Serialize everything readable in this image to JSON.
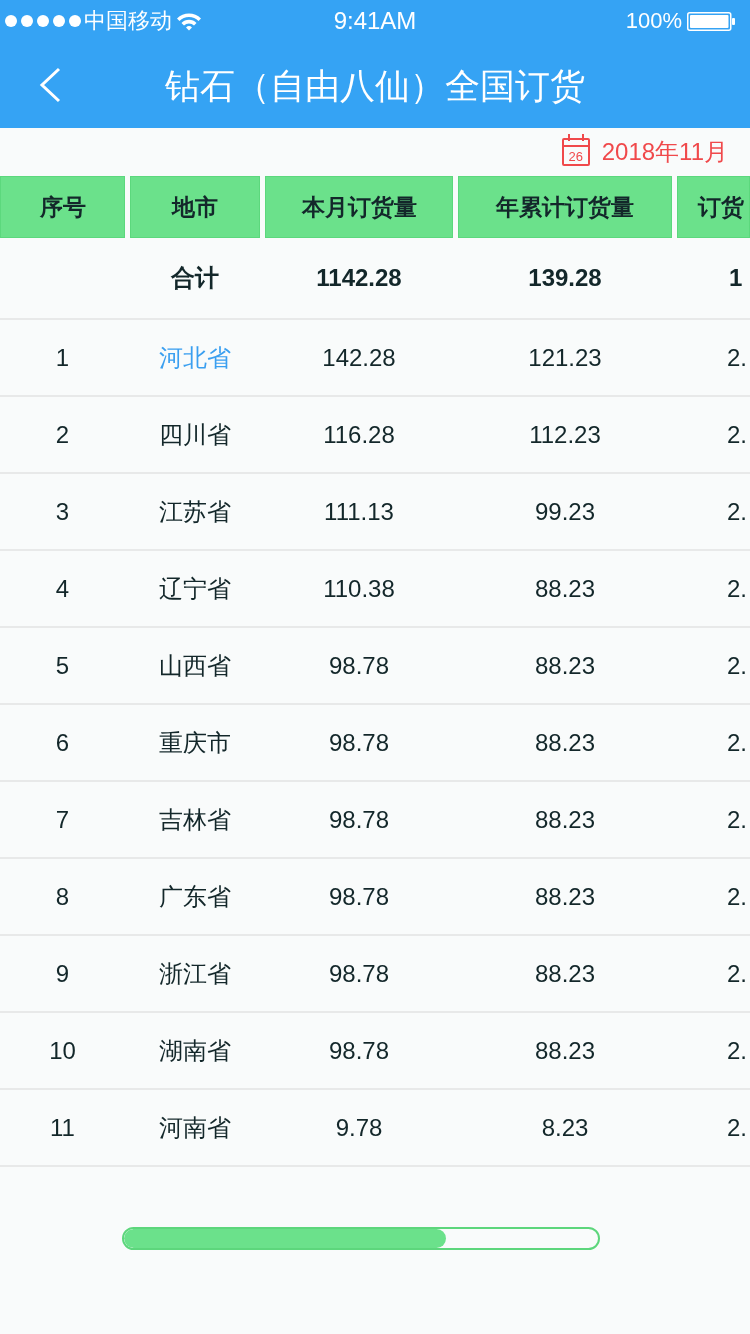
{
  "status_bar": {
    "carrier": "中国移动",
    "time": "9:41AM",
    "battery": "100%"
  },
  "nav": {
    "title": "钻石（自由八仙）全国订货"
  },
  "date": {
    "day": "26",
    "label": "2018年11月"
  },
  "table": {
    "columns": [
      "序号",
      "地市",
      "本月订货量",
      "年累计订货量",
      "订货"
    ],
    "total": {
      "label": "合计",
      "month": "1142.28",
      "year": "139.28",
      "column_5": "1"
    },
    "rows": [
      {
        "index": "1",
        "city": "河北省",
        "link": true,
        "month": "142.28",
        "year": "121.23",
        "column_5": "2."
      },
      {
        "index": "2",
        "city": "四川省",
        "link": false,
        "month": "116.28",
        "year": "112.23",
        "column_5": "2."
      },
      {
        "index": "3",
        "city": "江苏省",
        "link": false,
        "month": "111.13",
        "year": "99.23",
        "column_5": "2."
      },
      {
        "index": "4",
        "city": "辽宁省",
        "link": false,
        "month": "110.38",
        "year": "88.23",
        "column_5": "2."
      },
      {
        "index": "5",
        "city": "山西省",
        "link": false,
        "month": "98.78",
        "year": "88.23",
        "column_5": "2."
      },
      {
        "index": "6",
        "city": "重庆市",
        "link": false,
        "month": "98.78",
        "year": "88.23",
        "column_5": "2."
      },
      {
        "index": "7",
        "city": "吉林省",
        "link": false,
        "month": "98.78",
        "year": "88.23",
        "column_5": "2."
      },
      {
        "index": "8",
        "city": "广东省",
        "link": false,
        "month": "98.78",
        "year": "88.23",
        "column_5": "2."
      },
      {
        "index": "9",
        "city": "浙江省",
        "link": false,
        "month": "98.78",
        "year": "88.23",
        "column_5": "2."
      },
      {
        "index": "10",
        "city": "湖南省",
        "link": false,
        "month": "98.78",
        "year": "88.23",
        "column_5": "2."
      },
      {
        "index": "11",
        "city": "河南省",
        "link": false,
        "month": "9.78",
        "year": "8.23",
        "column_5": "2."
      }
    ]
  },
  "progress": {
    "level": 0.68
  }
}
